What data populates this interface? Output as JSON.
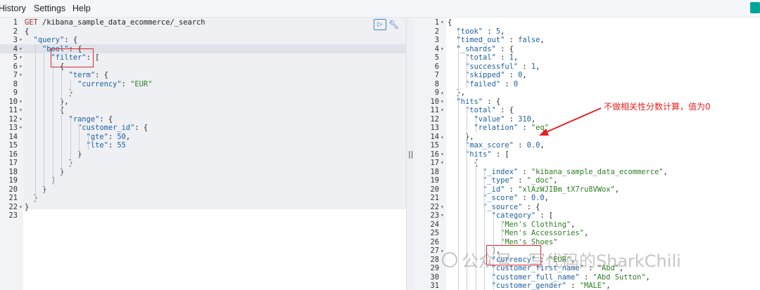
{
  "menu": [
    "History",
    "Settings",
    "Help"
  ],
  "request_lines": [
    {
      "n": "1",
      "f": "",
      "t": [
        [
          "m",
          "GET "
        ],
        [
          "p",
          "/kibana_sample_data_ecommerce/_search"
        ]
      ]
    },
    {
      "n": "2",
      "f": "",
      "t": [
        [
          "p",
          "{"
        ]
      ]
    },
    {
      "n": "3",
      "f": "▾",
      "t": [
        [
          "p",
          "  "
        ],
        [
          "k",
          "\"query\""
        ],
        [
          "p",
          ": {"
        ]
      ]
    },
    {
      "n": "4",
      "f": "▾",
      "t": [
        [
          "p",
          "    "
        ],
        [
          "k",
          "\"bool\""
        ],
        [
          "p",
          ": {"
        ]
      ]
    },
    {
      "n": "5",
      "f": "▾",
      "t": [
        [
          "p",
          "      "
        ],
        [
          "k",
          "\"filter\""
        ],
        [
          "p",
          ": ["
        ]
      ]
    },
    {
      "n": "6",
      "f": "▾",
      "t": [
        [
          "p",
          "        {"
        ]
      ]
    },
    {
      "n": "7",
      "f": "▾",
      "t": [
        [
          "p",
          "          "
        ],
        [
          "k",
          "\"term\""
        ],
        [
          "p",
          ": {"
        ]
      ]
    },
    {
      "n": "8",
      "f": "",
      "t": [
        [
          "p",
          "            "
        ],
        [
          "k",
          "\"currency\""
        ],
        [
          "p",
          ": "
        ],
        [
          "s",
          "\"EUR\""
        ]
      ]
    },
    {
      "n": "9",
      "f": "",
      "t": [
        [
          "p",
          "          }"
        ]
      ]
    },
    {
      "n": "10",
      "f": "▾",
      "t": [
        [
          "p",
          "        },"
        ]
      ]
    },
    {
      "n": "11",
      "f": "▾",
      "t": [
        [
          "p",
          "        {"
        ]
      ]
    },
    {
      "n": "12",
      "f": "▾",
      "t": [
        [
          "p",
          "          "
        ],
        [
          "k",
          "\"range\""
        ],
        [
          "p",
          ": {"
        ]
      ]
    },
    {
      "n": "13",
      "f": "▾",
      "t": [
        [
          "p",
          "            "
        ],
        [
          "k",
          "\"customer_id\""
        ],
        [
          "p",
          ": {"
        ]
      ]
    },
    {
      "n": "14",
      "f": "",
      "t": [
        [
          "p",
          "              "
        ],
        [
          "k",
          "\"gte\""
        ],
        [
          "p",
          ": "
        ],
        [
          "n",
          "50"
        ],
        [
          "p",
          ","
        ]
      ]
    },
    {
      "n": "15",
      "f": "",
      "t": [
        [
          "p",
          "              "
        ],
        [
          "k",
          "\"lte\""
        ],
        [
          "p",
          ": "
        ],
        [
          "n",
          "55"
        ]
      ]
    },
    {
      "n": "16",
      "f": "",
      "t": [
        [
          "p",
          "            }"
        ]
      ]
    },
    {
      "n": "17",
      "f": "",
      "t": [
        [
          "p",
          "          }"
        ]
      ]
    },
    {
      "n": "18",
      "f": "",
      "t": [
        [
          "p",
          "        }"
        ]
      ]
    },
    {
      "n": "19",
      "f": "",
      "t": [
        [
          "p",
          "      ]"
        ]
      ]
    },
    {
      "n": "20",
      "f": "",
      "t": [
        [
          "p",
          "    }"
        ]
      ]
    },
    {
      "n": "21",
      "f": "",
      "t": [
        [
          "p",
          "  }"
        ]
      ]
    },
    {
      "n": "22",
      "f": "▾",
      "t": [
        [
          "p",
          "}"
        ]
      ]
    },
    {
      "n": "23",
      "f": "",
      "t": []
    }
  ],
  "response_lines": [
    {
      "n": "1",
      "f": "▾",
      "t": [
        [
          "p",
          "{"
        ]
      ]
    },
    {
      "n": "2",
      "f": "",
      "t": [
        [
          "p",
          "  "
        ],
        [
          "k",
          "\"took\""
        ],
        [
          "p",
          " : "
        ],
        [
          "n",
          "5"
        ],
        [
          "p",
          ","
        ]
      ]
    },
    {
      "n": "3",
      "f": "",
      "t": [
        [
          "p",
          "  "
        ],
        [
          "k",
          "\"timed_out\""
        ],
        [
          "p",
          " : "
        ],
        [
          "n",
          "false"
        ],
        [
          "p",
          ","
        ]
      ]
    },
    {
      "n": "4",
      "f": "▾",
      "t": [
        [
          "p",
          "  "
        ],
        [
          "k",
          "\"_shards\""
        ],
        [
          "p",
          " : {"
        ]
      ]
    },
    {
      "n": "5",
      "f": "",
      "t": [
        [
          "p",
          "    "
        ],
        [
          "k",
          "\"total\""
        ],
        [
          "p",
          " : "
        ],
        [
          "n",
          "1"
        ],
        [
          "p",
          ","
        ]
      ]
    },
    {
      "n": "6",
      "f": "",
      "t": [
        [
          "p",
          "    "
        ],
        [
          "k",
          "\"successful\""
        ],
        [
          "p",
          " : "
        ],
        [
          "n",
          "1"
        ],
        [
          "p",
          ","
        ]
      ]
    },
    {
      "n": "7",
      "f": "",
      "t": [
        [
          "p",
          "    "
        ],
        [
          "k",
          "\"skipped\""
        ],
        [
          "p",
          " : "
        ],
        [
          "n",
          "0"
        ],
        [
          "p",
          ","
        ]
      ]
    },
    {
      "n": "8",
      "f": "",
      "t": [
        [
          "p",
          "    "
        ],
        [
          "k",
          "\"failed\""
        ],
        [
          "p",
          " : "
        ],
        [
          "n",
          "0"
        ]
      ]
    },
    {
      "n": "9",
      "f": "▴",
      "t": [
        [
          "p",
          "  },"
        ]
      ]
    },
    {
      "n": "10",
      "f": "▾",
      "t": [
        [
          "p",
          "  "
        ],
        [
          "k",
          "\"hits\""
        ],
        [
          "p",
          " : {"
        ]
      ]
    },
    {
      "n": "11",
      "f": "▾",
      "t": [
        [
          "p",
          "    "
        ],
        [
          "k",
          "\"total\""
        ],
        [
          "p",
          " : {"
        ]
      ]
    },
    {
      "n": "12",
      "f": "",
      "t": [
        [
          "p",
          "      "
        ],
        [
          "k",
          "\"value\""
        ],
        [
          "p",
          " : "
        ],
        [
          "n",
          "310"
        ],
        [
          "p",
          ","
        ]
      ]
    },
    {
      "n": "13",
      "f": "",
      "t": [
        [
          "p",
          "      "
        ],
        [
          "k",
          "\"relation\""
        ],
        [
          "p",
          " : "
        ],
        [
          "s",
          "\"eq\""
        ]
      ]
    },
    {
      "n": "14",
      "f": "▴",
      "t": [
        [
          "p",
          "    },"
        ]
      ]
    },
    {
      "n": "15",
      "f": "",
      "t": [
        [
          "p",
          "    "
        ],
        [
          "k",
          "\"max_score\""
        ],
        [
          "p",
          " : "
        ],
        [
          "n",
          "0.0"
        ],
        [
          "p",
          ","
        ]
      ]
    },
    {
      "n": "16",
      "f": "▾",
      "t": [
        [
          "p",
          "    "
        ],
        [
          "k",
          "\"hits\""
        ],
        [
          "p",
          " : ["
        ]
      ]
    },
    {
      "n": "17",
      "f": "▾",
      "t": [
        [
          "p",
          "      {"
        ]
      ]
    },
    {
      "n": "18",
      "f": "",
      "t": [
        [
          "p",
          "        "
        ],
        [
          "k",
          "\"_index\""
        ],
        [
          "p",
          " : "
        ],
        [
          "s",
          "\"kibana_sample_data_ecommerce\""
        ],
        [
          "p",
          ","
        ]
      ]
    },
    {
      "n": "19",
      "f": "",
      "t": [
        [
          "p",
          "        "
        ],
        [
          "k",
          "\"_type\""
        ],
        [
          "p",
          " : "
        ],
        [
          "s",
          "\"_doc\""
        ],
        [
          "p",
          ","
        ]
      ]
    },
    {
      "n": "20",
      "f": "",
      "t": [
        [
          "p",
          "        "
        ],
        [
          "k",
          "\"_id\""
        ],
        [
          "p",
          " : "
        ],
        [
          "s",
          "\"xlAzWJIBm_tX7ru8VWox\""
        ],
        [
          "p",
          ","
        ]
      ]
    },
    {
      "n": "21",
      "f": "",
      "t": [
        [
          "p",
          "        "
        ],
        [
          "k",
          "\"_score\""
        ],
        [
          "p",
          " : "
        ],
        [
          "n",
          "0.0"
        ],
        [
          "p",
          ","
        ]
      ]
    },
    {
      "n": "22",
      "f": "▾",
      "t": [
        [
          "p",
          "        "
        ],
        [
          "k",
          "\"_source\""
        ],
        [
          "p",
          " : {"
        ]
      ]
    },
    {
      "n": "23",
      "f": "▾",
      "t": [
        [
          "p",
          "          "
        ],
        [
          "k",
          "\"category\""
        ],
        [
          "p",
          " : ["
        ]
      ]
    },
    {
      "n": "24",
      "f": "",
      "t": [
        [
          "p",
          "            "
        ],
        [
          "s",
          "\"Men's Clothing\""
        ],
        [
          "p",
          ","
        ]
      ]
    },
    {
      "n": "25",
      "f": "",
      "t": [
        [
          "p",
          "            "
        ],
        [
          "s",
          "\"Men's Accessories\""
        ],
        [
          "p",
          ","
        ]
      ]
    },
    {
      "n": "26",
      "f": "",
      "t": [
        [
          "p",
          "            "
        ],
        [
          "s",
          "\"Men's Shoes\""
        ]
      ]
    },
    {
      "n": "27",
      "f": "▴",
      "t": [
        [
          "p",
          "          ],"
        ]
      ]
    },
    {
      "n": "28",
      "f": "",
      "t": [
        [
          "p",
          "          "
        ],
        [
          "k",
          "\"currency\""
        ],
        [
          "p",
          " : "
        ],
        [
          "s",
          "\"EUR\""
        ],
        [
          "p",
          ","
        ]
      ]
    },
    {
      "n": "29",
      "f": "",
      "t": [
        [
          "p",
          "          "
        ],
        [
          "k",
          "\"customer_first_name\""
        ],
        [
          "p",
          " : "
        ],
        [
          "s",
          "\"Abd\""
        ],
        [
          "p",
          ","
        ]
      ]
    },
    {
      "n": "30",
      "f": "",
      "t": [
        [
          "p",
          "          "
        ],
        [
          "k",
          "\"customer_full_name\""
        ],
        [
          "p",
          " : "
        ],
        [
          "s",
          "\"Abd Sutton\""
        ],
        [
          "p",
          ","
        ]
      ]
    },
    {
      "n": "31",
      "f": "",
      "t": [
        [
          "p",
          "          "
        ],
        [
          "k",
          "\"customer_gender\""
        ],
        [
          "p",
          " : "
        ],
        [
          "s",
          "\"MALE\""
        ],
        [
          "p",
          ","
        ]
      ]
    }
  ],
  "annotation": "不做相关性分数计算，值为0",
  "watermark": "公众号 · 写代码的SharkChili",
  "colors": {
    "annotation_red": "#e81f1f",
    "accent_teal": "#00a69b",
    "key_blue": "#1c5f9e",
    "string_green": "#2d7d22"
  },
  "icons": {
    "run": "play-triangle-icon",
    "settings": "wrench-icon"
  }
}
